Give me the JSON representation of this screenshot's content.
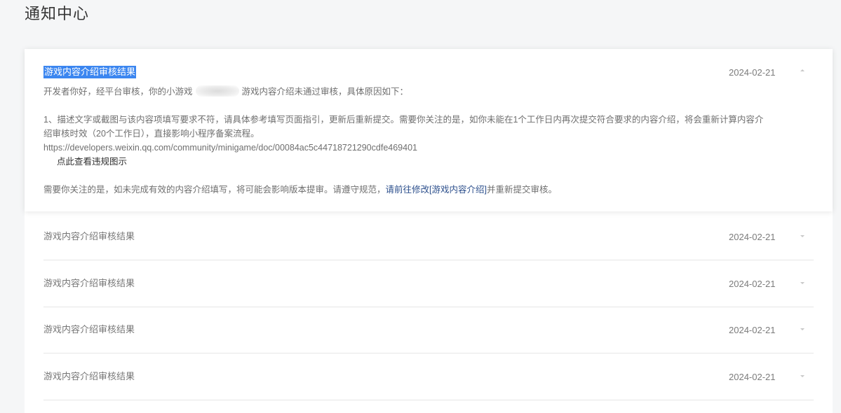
{
  "page": {
    "title": "通知中心"
  },
  "expanded": {
    "title": "游戏内容介绍审核结果",
    "date": "2024-02-21",
    "greeting_prefix": "开发者你好，经平台审核，你的小游戏",
    "greeting_suffix": "游戏内容介绍未通过审核，具体原因如下：",
    "reason_line1": "1、描述文字或截图与该内容项填写要求不符，请具体参考填写页面指引，更新后重新提交。需要你关注的是，如你未能在1个工作日内再次提交符合要求的内容介绍，将会重新计算内容介",
    "reason_line2": "绍审核时效（20个工作日），直接影响小程序备案流程。",
    "url": "https://developers.weixin.qq.com/community/minigame/doc/00084ac5c44718721290cdfe469401",
    "view_example_link": "点此查看违规图示",
    "footer_prefix": "需要你关注的是，如未完成有效的内容介绍填写，将可能会影响版本提审。请遵守规范，",
    "footer_link": "请前往修改[游戏内容介绍]",
    "footer_suffix": "并重新提交审核。"
  },
  "notifications": [
    {
      "title": "游戏内容介绍审核结果",
      "date": "2024-02-21"
    },
    {
      "title": "游戏内容介绍审核结果",
      "date": "2024-02-21"
    },
    {
      "title": "游戏内容介绍审核结果",
      "date": "2024-02-21"
    },
    {
      "title": "游戏内容介绍审核结果",
      "date": "2024-02-21"
    }
  ]
}
